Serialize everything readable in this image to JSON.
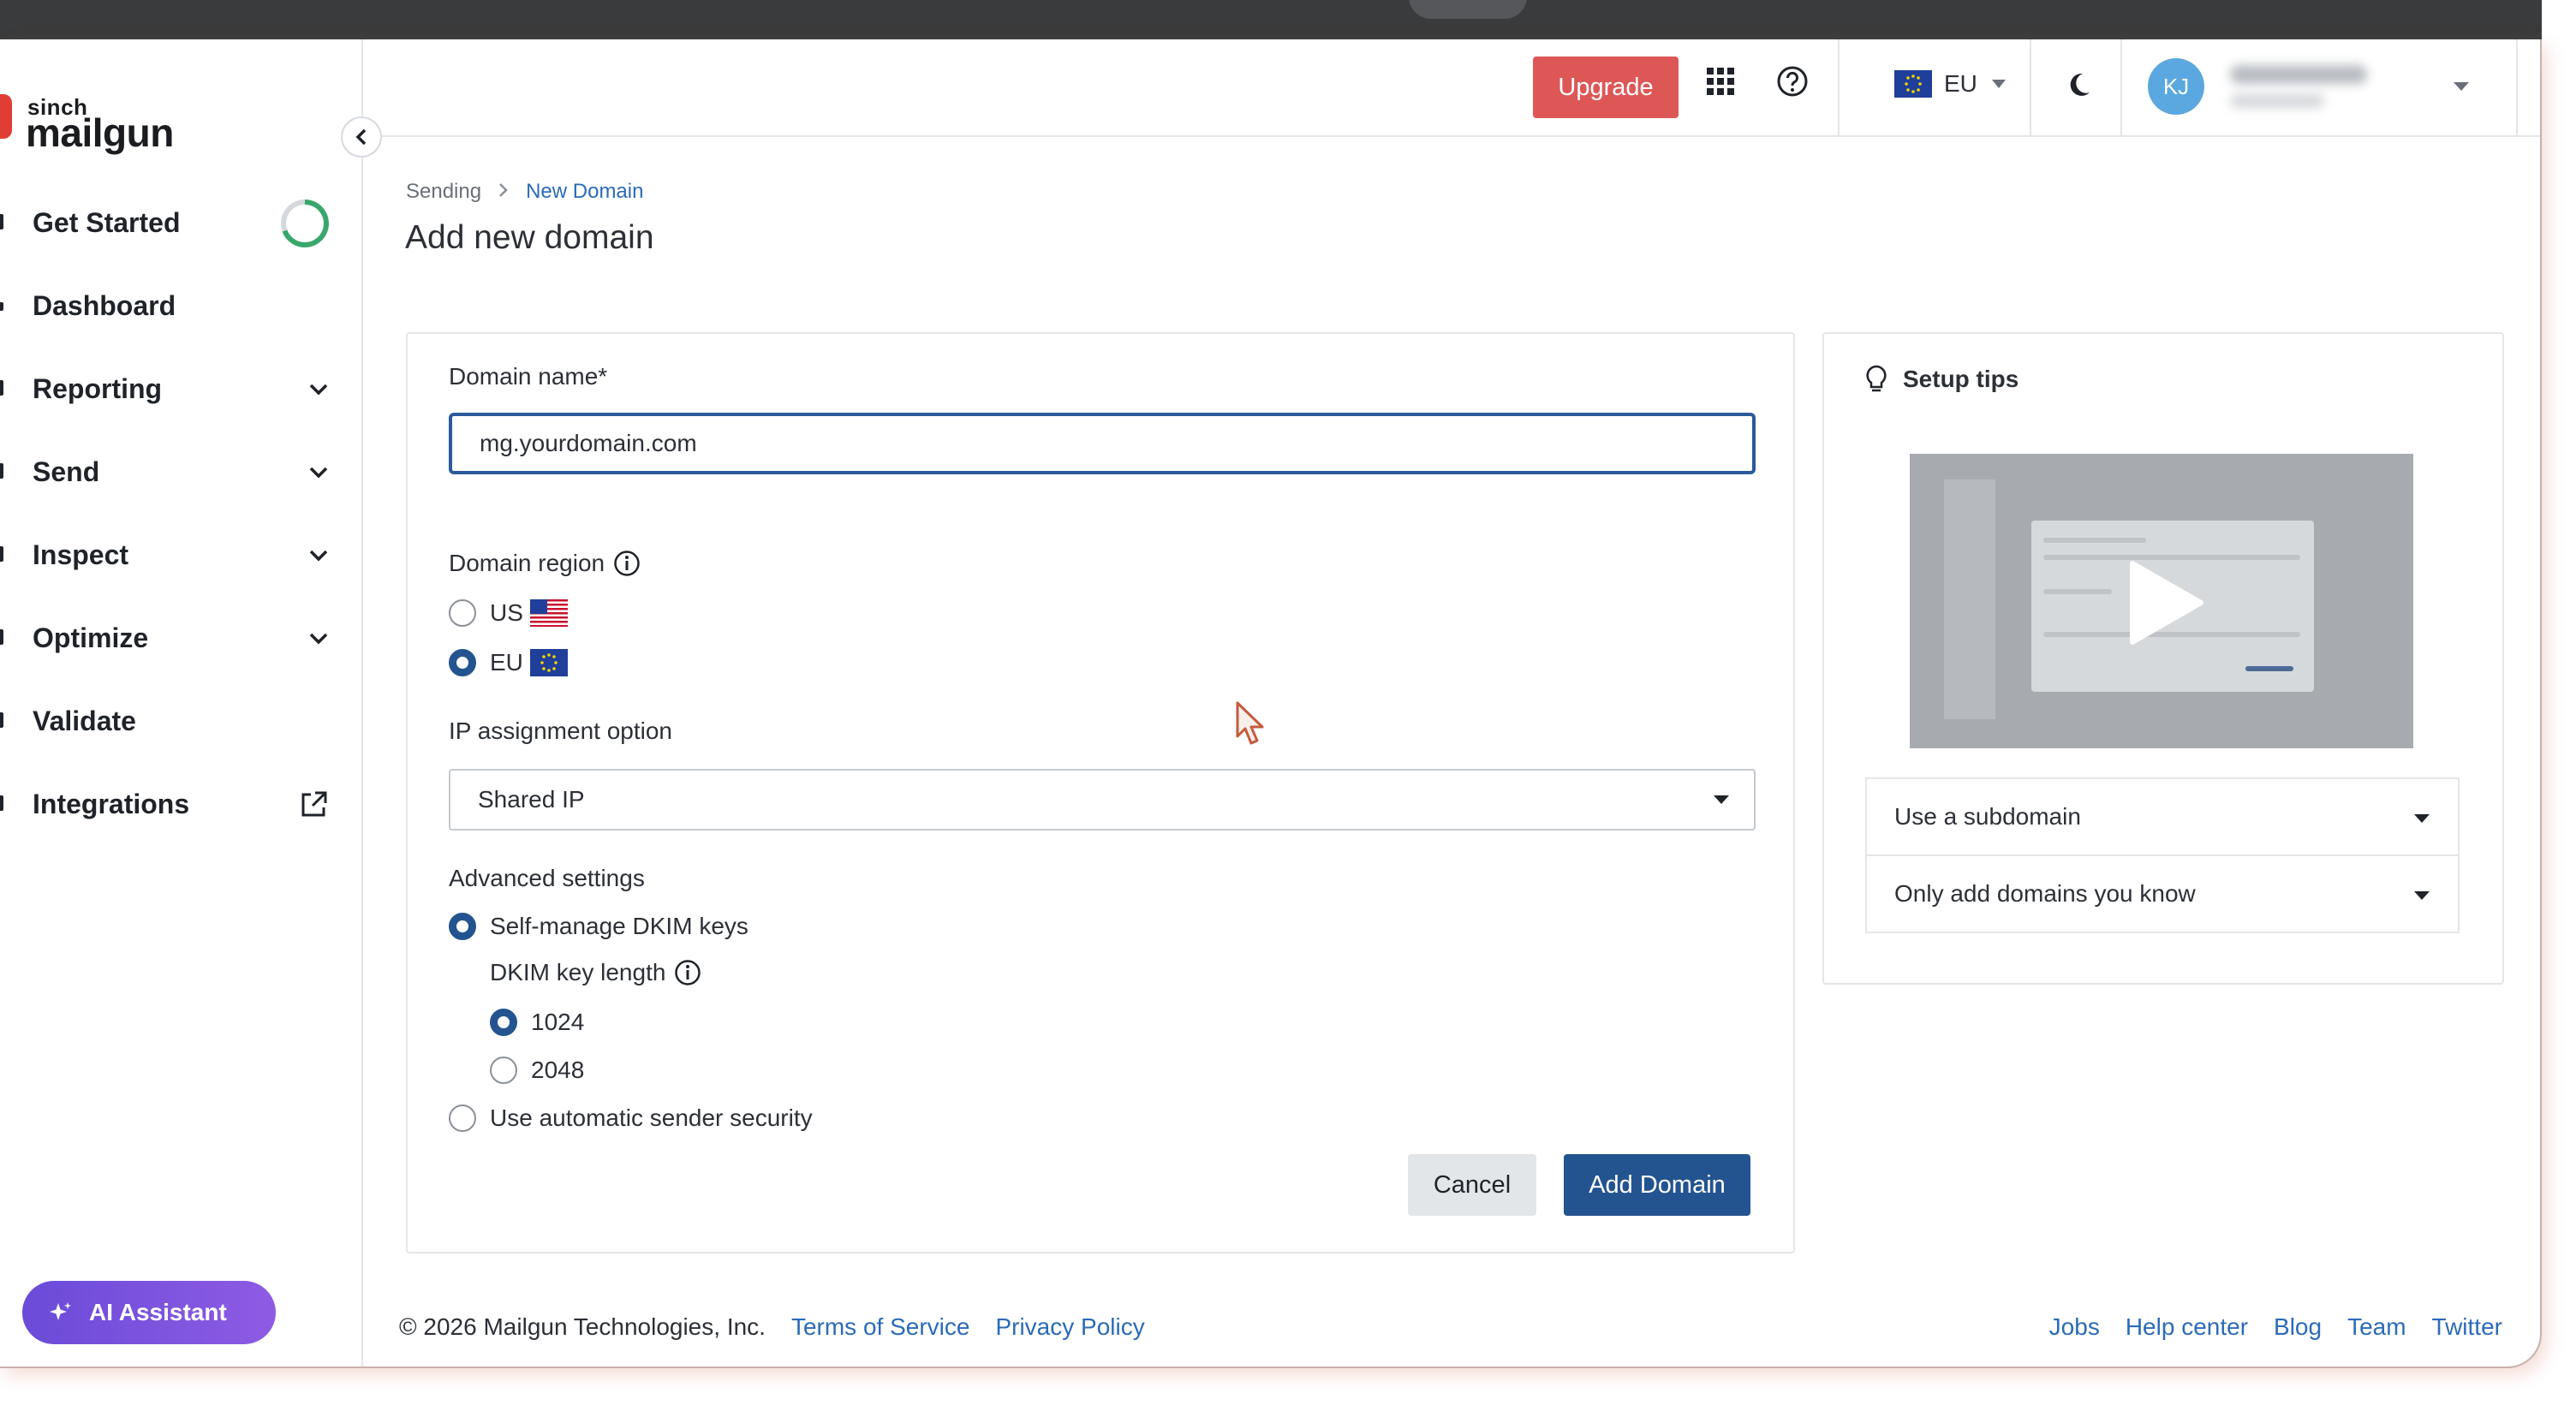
{
  "brand": {
    "sinch": "sinch",
    "name": "mailgun",
    "accent": "#e03d35"
  },
  "sidebar": {
    "items": [
      {
        "label": "Get Started"
      },
      {
        "label": "Dashboard"
      },
      {
        "label": "Reporting"
      },
      {
        "label": "Send"
      },
      {
        "label": "Inspect"
      },
      {
        "label": "Optimize"
      },
      {
        "label": "Validate"
      },
      {
        "label": "Integrations"
      }
    ],
    "ai_assistant": "AI Assistant"
  },
  "header": {
    "upgrade": "Upgrade",
    "region": "EU",
    "avatar_initials": "KJ"
  },
  "breadcrumb": {
    "parent": "Sending",
    "current": "New Domain"
  },
  "page_title": "Add new domain",
  "form": {
    "domain_label": "Domain name*",
    "domain_value": "mg.yourdomain.com",
    "region_label": "Domain region",
    "region_options": [
      {
        "label": "US",
        "selected": false
      },
      {
        "label": "EU",
        "selected": true
      }
    ],
    "ip_label": "IP assignment option",
    "ip_value": "Shared IP",
    "advanced_label": "Advanced settings",
    "self_manage": "Self-manage DKIM keys",
    "dkim_label": "DKIM key length",
    "dkim_options": [
      {
        "label": "1024",
        "selected": true
      },
      {
        "label": "2048",
        "selected": false
      }
    ],
    "auto_security": "Use automatic sender security",
    "cancel": "Cancel",
    "add": "Add Domain"
  },
  "tips": {
    "title": "Setup tips",
    "accordion": [
      "Use a subdomain",
      "Only add domains you know"
    ]
  },
  "footer": {
    "copyright": "© 2026 Mailgun Technologies, Inc.",
    "terms": "Terms of Service",
    "privacy": "Privacy Policy",
    "right_links": [
      "Jobs",
      "Help center",
      "Blog",
      "Team",
      "Twitter"
    ]
  },
  "colors": {
    "primary": "#24548f",
    "upgrade": "#dd5757",
    "link": "#2b6bb8",
    "ai": "#7a52de"
  }
}
